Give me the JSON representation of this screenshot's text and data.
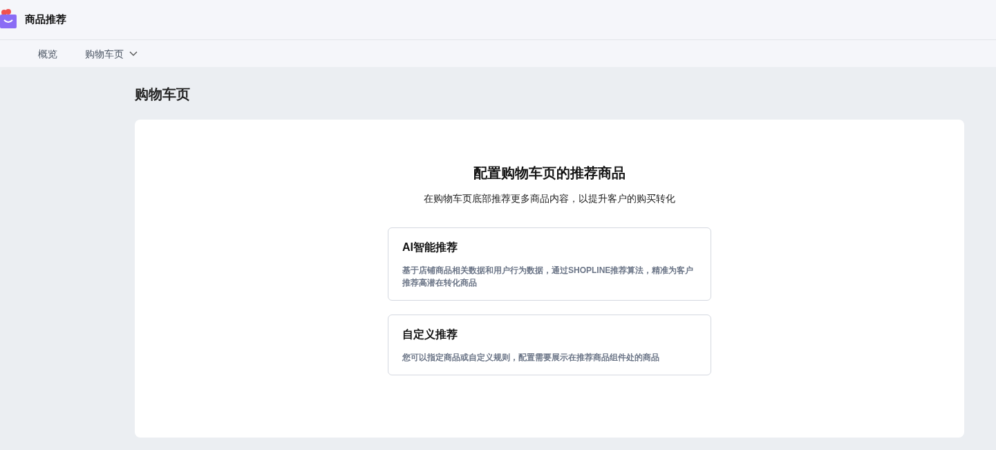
{
  "app": {
    "title": "商品推荐"
  },
  "nav": [
    {
      "label": "概览",
      "dropdown": false
    },
    {
      "label": "购物车页",
      "dropdown": true
    }
  ],
  "page": {
    "title": "购物车页",
    "heading": "配置购物车页的推荐商品",
    "subheading": "在购物车页底部推荐更多商品内容，以提升客户的购买转化",
    "options": [
      {
        "title": "AI智能推荐",
        "description": "基于店铺商品相关数据和用户行为数据，通过SHOPLINE推荐算法，精准为客户推荐高潜在转化商品"
      },
      {
        "title": "自定义推荐",
        "description": "您可以指定商品或自定义规则，配置需要展示在推荐商品组件处的商品"
      }
    ]
  }
}
